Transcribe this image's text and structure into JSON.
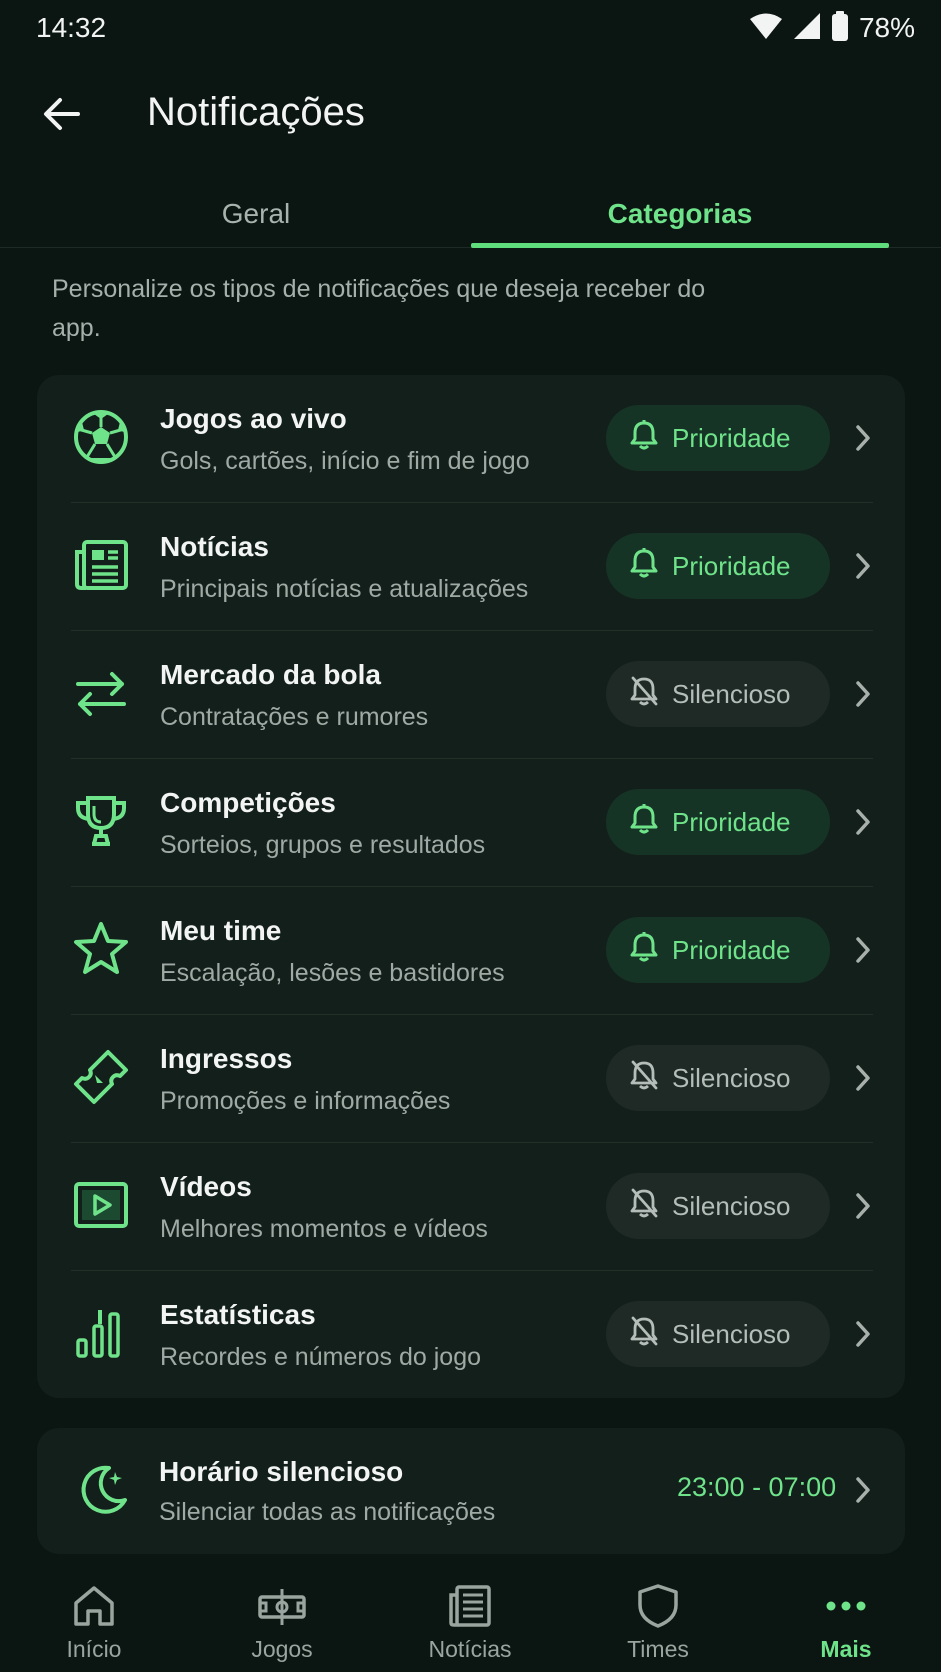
{
  "status": {
    "time": "14:32",
    "battery": "78%"
  },
  "header": {
    "title": "Notificações"
  },
  "tabs": [
    {
      "label": "Geral",
      "active": false
    },
    {
      "label": "Categorias",
      "active": true
    }
  ],
  "intro": "Personalize os tipos de notificações que deseja receber do app.",
  "categories": [
    {
      "icon": "soccer-ball-icon",
      "title": "Jogos ao vivo",
      "subtitle": "Gols, cartões, início e fim de jogo",
      "status": "Prioridade"
    },
    {
      "icon": "newspaper-icon",
      "title": "Notícias",
      "subtitle": "Principais notícias e atualizações",
      "status": "Prioridade"
    },
    {
      "icon": "transfer-arrows-icon",
      "title": "Mercado da bola",
      "subtitle": "Contratações e rumores",
      "status": "Silencioso"
    },
    {
      "icon": "trophy-icon",
      "title": "Competições",
      "subtitle": "Sorteios, grupos e resultados",
      "status": "Prioridade"
    },
    {
      "icon": "star-icon",
      "title": "Meu time",
      "subtitle": "Escalação, lesões e bastidores",
      "status": "Prioridade"
    },
    {
      "icon": "ticket-icon",
      "title": "Ingressos",
      "subtitle": "Promoções e informações",
      "status": "Silencioso"
    },
    {
      "icon": "video-icon",
      "title": "Vídeos",
      "subtitle": "Melhores momentos e vídeos",
      "status": "Silencioso"
    },
    {
      "icon": "bar-chart-icon",
      "title": "Estatísticas",
      "subtitle": "Recordes e números do jogo",
      "status": "Silencioso"
    }
  ],
  "quiet_hours": {
    "title": "Horário silencioso",
    "subtitle": "Silenciar todas as notificações",
    "range": "23:00 - 07:00"
  },
  "nav": [
    {
      "icon": "home-icon",
      "label": "Início",
      "active": false
    },
    {
      "icon": "match-icon",
      "label": "Jogos",
      "active": false
    },
    {
      "icon": "news-icon",
      "label": "Notícias",
      "active": false
    },
    {
      "icon": "shield-icon",
      "label": "Times",
      "active": false
    },
    {
      "icon": "more-icon",
      "label": "Mais",
      "active": true
    }
  ],
  "colors": {
    "accent": "#6fe38a",
    "background": "#0b1512",
    "card": "#131f1b",
    "priority_pill": "#163426",
    "silent_pill": "#1f2a27"
  }
}
